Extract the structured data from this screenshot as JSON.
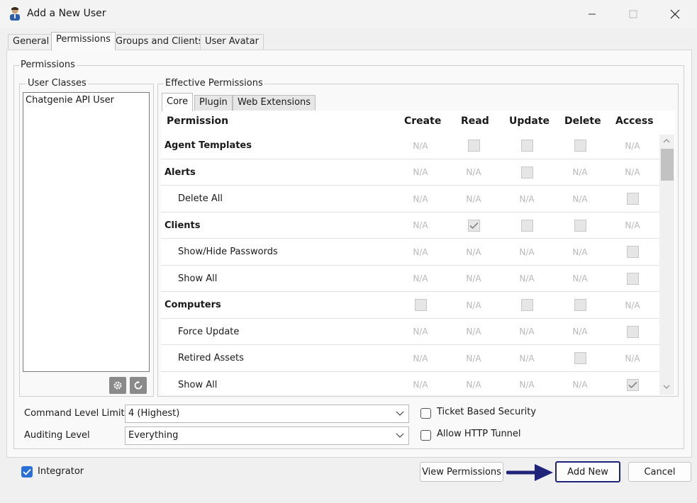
{
  "window": {
    "title": "Add a New User"
  },
  "tabs": [
    "General",
    "Permissions",
    "Groups and Clients",
    "User Avatar"
  ],
  "permissions_group": {
    "label": "Permissions"
  },
  "user_classes": {
    "label": "User Classes",
    "items": [
      "Chatgenie API User"
    ]
  },
  "effective_permissions": {
    "label": "Effective Permissions",
    "subtabs": [
      "Core",
      "Plugin",
      "Web Extensions"
    ],
    "columns": [
      "Permission",
      "Create",
      "Read",
      "Update",
      "Delete",
      "Access"
    ],
    "na_text": "N/A",
    "rows": [
      {
        "label": "Agent Templates",
        "parent": true,
        "cells": [
          "na",
          "cb",
          "cb",
          "cb",
          "na"
        ]
      },
      {
        "label": "Alerts",
        "parent": true,
        "cells": [
          "na",
          "na",
          "cb",
          "na",
          "na"
        ]
      },
      {
        "label": "Delete All",
        "parent": false,
        "cells": [
          "na",
          "na",
          "na",
          "na",
          "cb"
        ]
      },
      {
        "label": "Clients",
        "parent": true,
        "cells": [
          "na",
          "cbc",
          "cb",
          "cb",
          "na"
        ]
      },
      {
        "label": "Show/Hide Passwords",
        "parent": false,
        "cells": [
          "na",
          "na",
          "na",
          "na",
          "cb"
        ]
      },
      {
        "label": "Show All",
        "parent": false,
        "cells": [
          "na",
          "na",
          "na",
          "na",
          "cb"
        ]
      },
      {
        "label": "Computers",
        "parent": true,
        "cells": [
          "cb",
          "na",
          "cb",
          "cb",
          "na"
        ]
      },
      {
        "label": "Force Update",
        "parent": false,
        "cells": [
          "na",
          "na",
          "na",
          "na",
          "cb"
        ]
      },
      {
        "label": "Retired Assets",
        "parent": false,
        "cells": [
          "na",
          "na",
          "na",
          "cb",
          "na"
        ]
      },
      {
        "label": "Show All",
        "parent": false,
        "cells": [
          "na",
          "na",
          "na",
          "na",
          "cbc"
        ]
      }
    ]
  },
  "command_level": {
    "label": "Command Level Limit",
    "value": "4 (Highest)"
  },
  "auditing_level": {
    "label": "Auditing Level",
    "value": "Everything"
  },
  "ticket_based_security": {
    "label": "Ticket Based Security",
    "checked": false
  },
  "allow_http_tunnel": {
    "label": "Allow HTTP Tunnel",
    "checked": false
  },
  "integrator": {
    "label": "Integrator",
    "checked": true
  },
  "buttons": {
    "view_permissions": "View Permissions",
    "add_new": "Add New",
    "cancel": "Cancel"
  },
  "colors": {
    "accent": "#1f2478",
    "checkbox_checked": "#2a6fd6"
  }
}
